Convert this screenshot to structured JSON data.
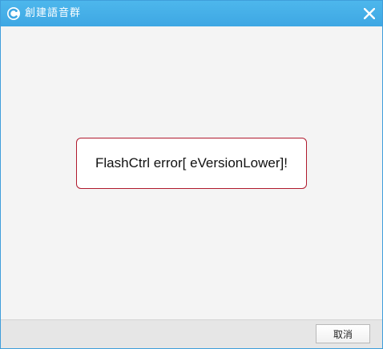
{
  "window": {
    "title": "創建語音群",
    "app_icon": "app-logo-icon",
    "close_icon": "close-icon"
  },
  "message": {
    "text": "FlashCtrl error[ eVersionLower]!"
  },
  "footer": {
    "cancel_label": "取消"
  },
  "colors": {
    "titlebar": "#45afe8",
    "error_border": "#b01a2e",
    "background": "#f4f4f4"
  }
}
